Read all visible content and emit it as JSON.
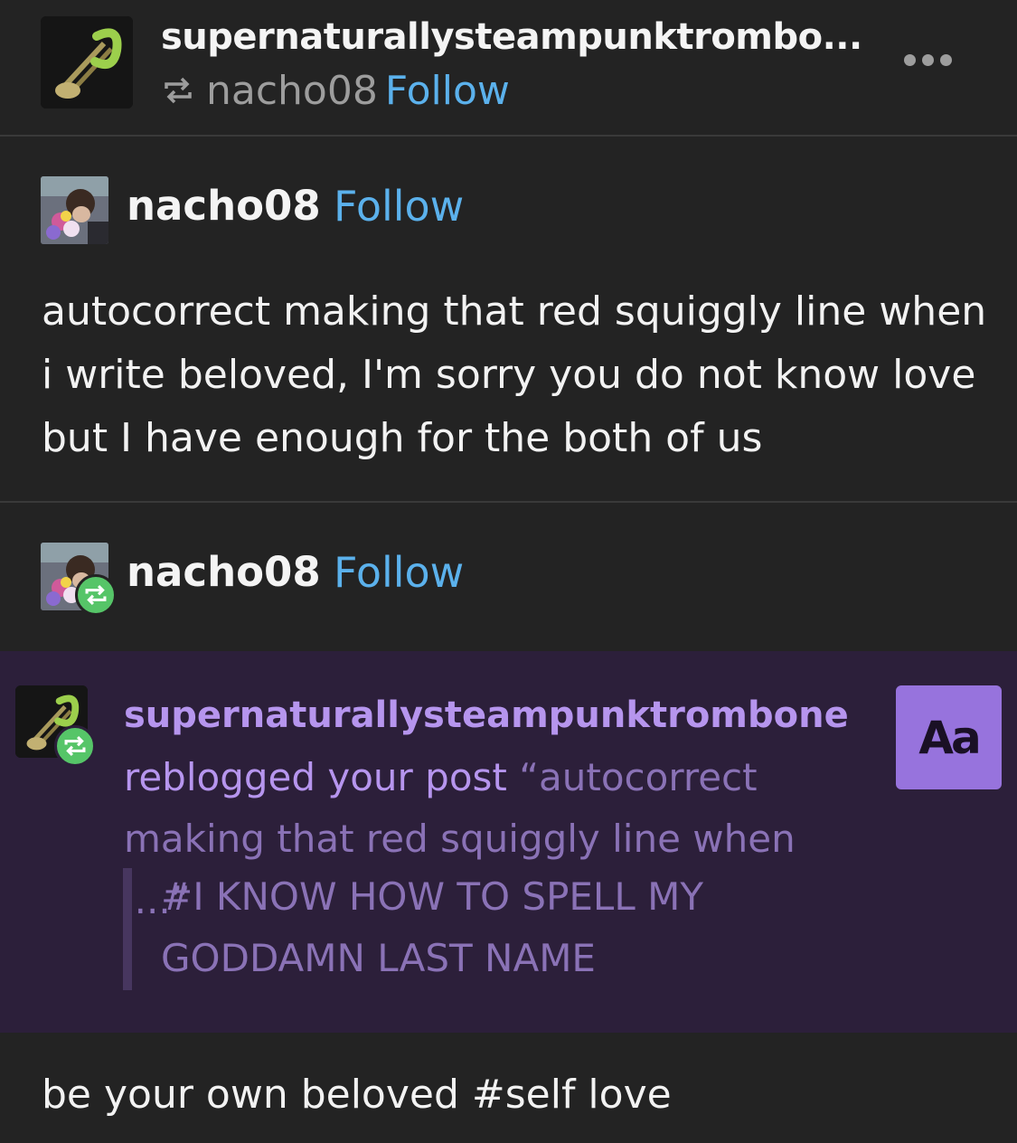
{
  "header": {
    "title": "supernaturallysteampunktrombo...",
    "reblogged_from": "nacho08",
    "follow_label": "Follow",
    "avatar_icon": "trombone-icon",
    "more_icon": "more-horizontal-icon"
  },
  "original_post": {
    "author": "nacho08",
    "follow_label": "Follow",
    "text": " autocorrect making that red squiggly line when i write beloved, I'm sorry you do not know love but I have enough for the both of us"
  },
  "reblog_entry": {
    "author": "nacho08",
    "follow_label": "Follow",
    "badge_icon": "reblog-icon"
  },
  "notification": {
    "username": "supernaturallysteampunktrombone",
    "action": "reblogged your post",
    "quote": "“autocorrect making that red squiggly line when i...”",
    "tags": "#I KNOW HOW TO SPELL MY GODDAMN LAST NAME",
    "aa_label": "Aa"
  },
  "bottom": {
    "text": "be your own beloved #self love"
  },
  "colors": {
    "background": "#232323",
    "link_blue": "#5bb1ec",
    "reblog_green": "#56c568",
    "notif_bg": "#2c1f3a",
    "notif_text": "#b695ee",
    "aa_button": "#9773dd"
  }
}
